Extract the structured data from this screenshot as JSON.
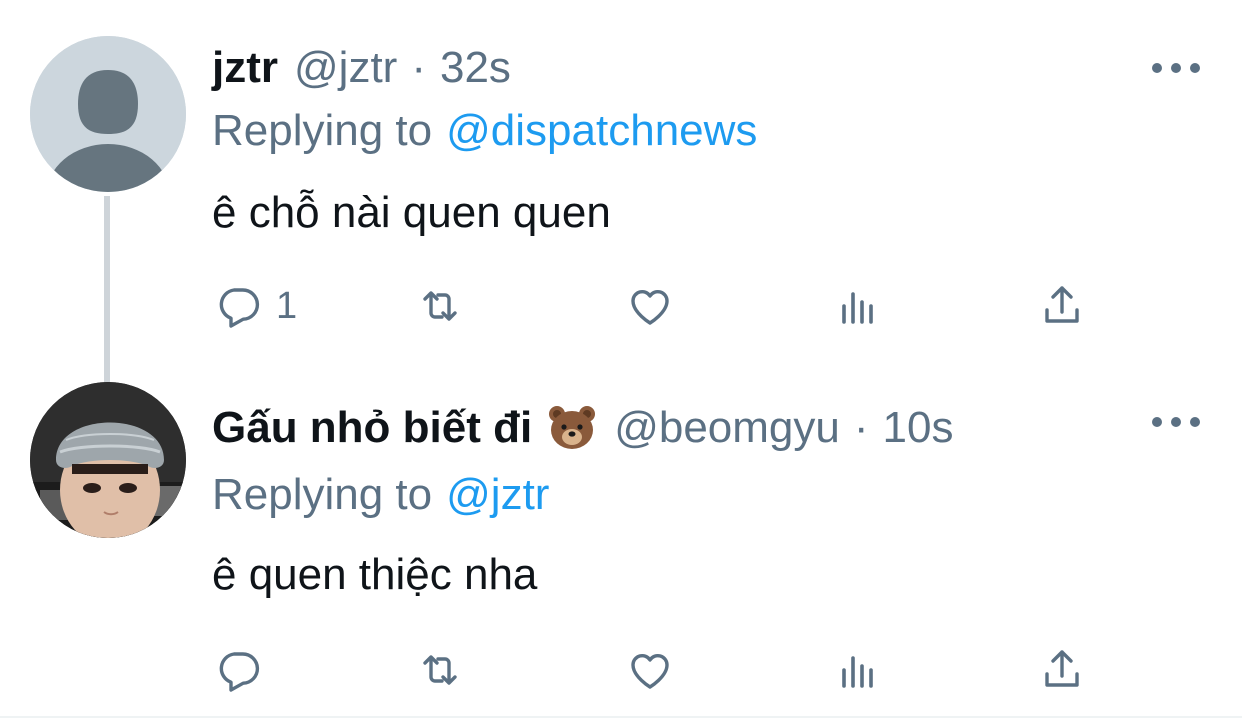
{
  "tweets": [
    {
      "name": "jztr",
      "handle": "@jztr",
      "separator": "·",
      "time": "32s",
      "replying_label": "Replying to",
      "replying_to": "@dispatchnews",
      "text": "ê chỗ nài quen quen",
      "reply_count": "1",
      "avatar": "default-avatar"
    },
    {
      "name": "Gấu nhỏ biết đi",
      "name_emoji": "bear-face-emoji",
      "handle": "@beomgyu",
      "separator": "·",
      "time": "10s",
      "replying_label": "Replying to",
      "replying_to": "@jztr",
      "text": "ê quen thiệc nha",
      "reply_count": "",
      "avatar": "photo-avatar"
    }
  ],
  "colors": {
    "text": "#0f1419",
    "secondary": "#5b7083",
    "link": "#1d9bf0",
    "thread_line": "#ced4d9",
    "default_avatar_bg": "#ccd6dd"
  }
}
